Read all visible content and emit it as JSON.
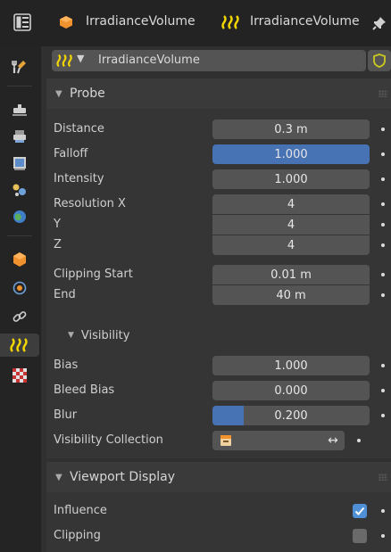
{
  "header": {
    "tab1_label": "IrradianceVolume",
    "tab2_label": "IrradianceVolume",
    "datablock_name": "IrradianceVolume"
  },
  "icons": {
    "editor_type": "properties-editor-icon",
    "object": "object-orange-cube-icon",
    "lightprobe": "lightprobe-grid-icon",
    "pin": "pin-icon",
    "fake_user": "shield-icon"
  },
  "colors": {
    "accent": "#4772b3",
    "checkbox_on": "#4f8fd6",
    "lightprobe_yellow": "#f2d600",
    "object_orange": "#f0922d"
  },
  "probe_panel": {
    "title": "Probe",
    "rows": [
      {
        "label": "Distance",
        "value": "0.3 m"
      },
      {
        "label": "Falloff",
        "value": "1.000"
      },
      {
        "label": "Intensity",
        "value": "1.000"
      },
      {
        "label": "Resolution X",
        "value": "4"
      },
      {
        "label": "Y",
        "value": "4"
      },
      {
        "label": "Z",
        "value": "4"
      },
      {
        "label": "Clipping Start",
        "value": "0.01 m"
      },
      {
        "label": "End",
        "value": "40 m"
      }
    ]
  },
  "visibility_panel": {
    "title": "Visibility",
    "rows": [
      {
        "label": "Bias",
        "value": "1.000"
      },
      {
        "label": "Bleed Bias",
        "value": "0.000"
      },
      {
        "label": "Blur",
        "value": "0.200",
        "fill_fraction": 0.2
      },
      {
        "label": "Visibility Collection",
        "value": ""
      }
    ]
  },
  "viewport_panel": {
    "title": "Viewport Display",
    "rows": [
      {
        "label": "Influence",
        "checked": true
      },
      {
        "label": "Clipping",
        "checked": false
      }
    ]
  }
}
